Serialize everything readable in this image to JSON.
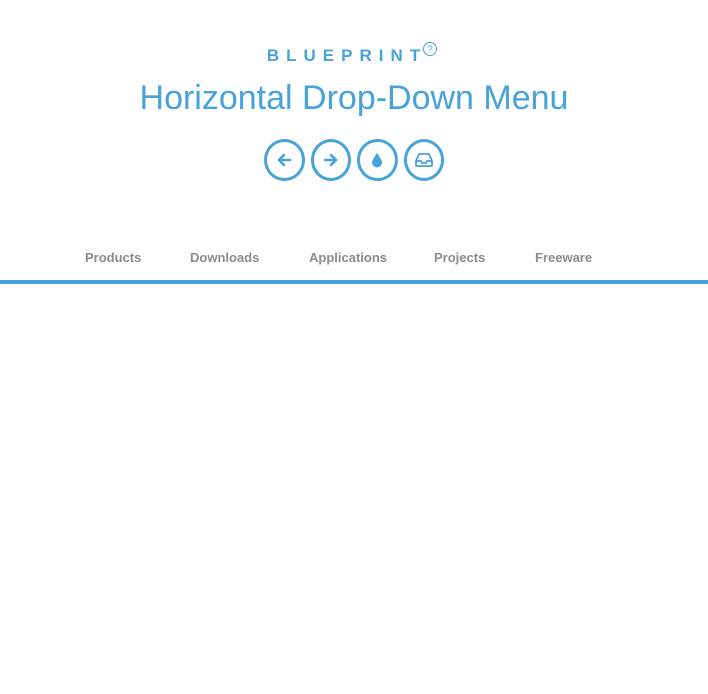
{
  "header": {
    "brand": "BLUEPRINT",
    "help_symbol": "?",
    "title": "Horizontal Drop-Down Menu",
    "icon_buttons": [
      {
        "icon": "arrow-left-icon"
      },
      {
        "icon": "arrow-right-icon"
      },
      {
        "icon": "drop-icon"
      },
      {
        "icon": "inbox-icon"
      }
    ],
    "accent_color": "#47a3da"
  },
  "menu": {
    "items": [
      {
        "label": "Products"
      },
      {
        "label": "Downloads"
      },
      {
        "label": "Applications"
      },
      {
        "label": "Projects"
      },
      {
        "label": "Freeware"
      }
    ],
    "text_color": "#8c8c8c",
    "border_color": "#47a3da"
  }
}
